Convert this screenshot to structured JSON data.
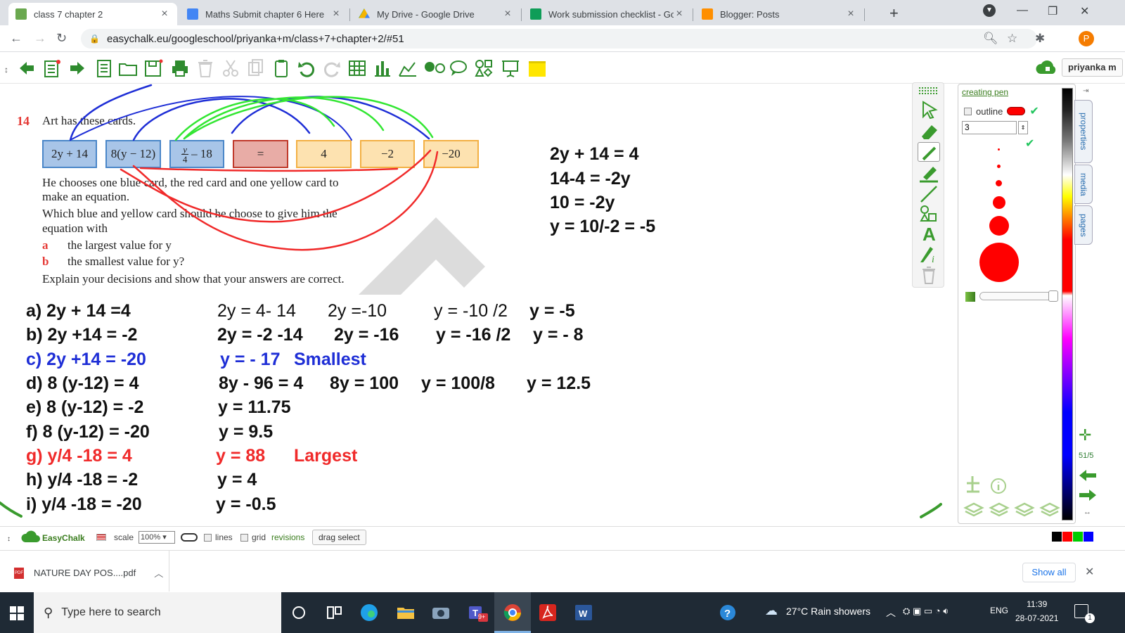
{
  "browser": {
    "tabs": [
      {
        "label": "class 7 chapter 2",
        "icon": "easychalk-icon",
        "active": true
      },
      {
        "label": "Maths Submit chapter 6 Here",
        "icon": "classroom-icon"
      },
      {
        "label": "My Drive - Google Drive",
        "icon": "drive-icon"
      },
      {
        "label": "Work submission checklist - Goo",
        "icon": "sheets-icon"
      },
      {
        "label": "Blogger: Posts",
        "icon": "blogger-icon"
      }
    ],
    "url": "easychalk.eu/googleschool/priyanka+m/class+7+chapter+2/#51",
    "profile_initial": "P"
  },
  "toolbar": {
    "user": "priyanka m"
  },
  "question": {
    "number": "14",
    "intro": "Art has these cards.",
    "blue_cards": [
      "2y + 14",
      "8(y − 12)",
      "y/4 − 18"
    ],
    "red_card": "=",
    "yellow_cards": [
      "4",
      "−2",
      "−20"
    ],
    "frac_num": "y",
    "frac_den": "4",
    "frac_rest": "– 18",
    "line1": "He chooses one blue card, the red card and one yellow card to",
    "line2": "make an equation.",
    "line3": "Which blue and yellow card should he choose to give him the",
    "line4": "equation with",
    "part_a_letter": "a",
    "part_a": "the largest value for y",
    "part_b_letter": "b",
    "part_b": "the smallest value for y?",
    "explain": "Explain your decisions and show that your answers are correct."
  },
  "side_work": [
    "2y + 14 = 4",
    "14-4 = -2y",
    "10 = -2y",
    "y = 10/-2 = -5"
  ],
  "answers": {
    "a": {
      "eq": "a) 2y + 14 =4",
      "s1": "2y = 4- 14",
      "s2": "2y  =-10",
      "s3": "y = -10 /2",
      "s4": "y = -5"
    },
    "b": {
      "eq": "b) 2y +14 = -2",
      "s1": "2y = -2 -14",
      "s2": "2y = -16",
      "s3": "y = -16 /2",
      "s4": "y = - 8"
    },
    "c": {
      "eq": "c) 2y +14 = -20",
      "s1": "y = - 17",
      "note": "Smallest"
    },
    "d": {
      "eq": "d) 8 (y-12) = 4",
      "s1": "8y - 96 = 4",
      "s2": "8y = 100",
      "s3": "y  = 100/8",
      "s4": "y = 12.5"
    },
    "e": {
      "eq": "e) 8 (y-12) = -2",
      "s1": "y = 11.75"
    },
    "f": {
      "eq": "f) 8 (y-12) = -20",
      "s1": "y = 9.5"
    },
    "g": {
      "eq": "g) y/4 -18 = 4",
      "s1": "y = 88",
      "note": "Largest"
    },
    "h": {
      "eq": "h) y/4 -18 = -2",
      "s1": "y = 4"
    },
    "i": {
      "eq": "i) y/4 -18 = -20",
      "s1": "y = -0.5"
    }
  },
  "properties": {
    "title": "creating pen",
    "outline_label": "outline",
    "pen_size": "3",
    "tabs": [
      "properties",
      "media",
      "pages"
    ],
    "page_counter": "51/5"
  },
  "status": {
    "brand": "EasyChalk",
    "scale_label": "scale",
    "scale_value": "100%",
    "lines_label": "lines",
    "grid_label": "grid",
    "revisions_label": "revisions",
    "drag_select": "drag select"
  },
  "downloads": {
    "file": "NATURE DAY POS....pdf",
    "show_all": "Show all"
  },
  "taskbar": {
    "search_placeholder": "Type here to search",
    "weather": "27°C  Rain showers",
    "lang": "ENG",
    "time": "11:39",
    "date": "28-07-2021",
    "notifications": "1",
    "teams_badge": "9+"
  },
  "colors": {
    "ink_blue": "#1e2ed6",
    "ink_green": "#32e632",
    "ink_red": "#f02a2a",
    "brand_green": "#3a7d1e"
  }
}
